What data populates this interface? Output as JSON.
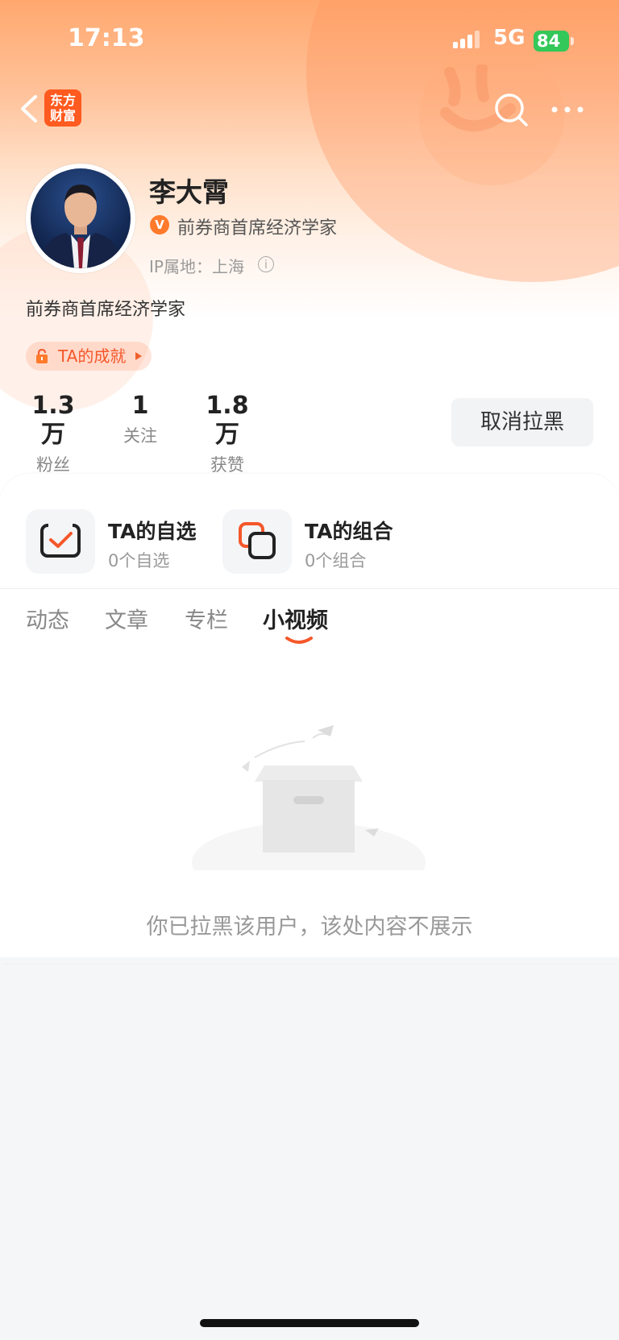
{
  "status_bar": {
    "time": "17:13",
    "network": "5G",
    "battery": "84"
  },
  "header": {
    "logo_text_1": "东方",
    "logo_text_2": "财富"
  },
  "profile": {
    "name": "李大霄",
    "verified_badge": "V",
    "verified_title": "前券商首席经济学家",
    "ip_location": "IP属地：上海",
    "bio": "前券商首席经济学家",
    "achievement_label": "TA的成就"
  },
  "stats": [
    {
      "value": "1.3万",
      "label": "粉丝"
    },
    {
      "value": "1",
      "label": "关注"
    },
    {
      "value": "1.8万",
      "label": "获赞"
    }
  ],
  "unblock_label": "取消拉黑",
  "cards": [
    {
      "title": "TA的自选",
      "subtitle": "0个自选"
    },
    {
      "title": "TA的组合",
      "subtitle": "0个组合"
    }
  ],
  "tabs": [
    {
      "label": "动态",
      "active": false
    },
    {
      "label": "文章",
      "active": false
    },
    {
      "label": "专栏",
      "active": false
    },
    {
      "label": "小视频",
      "active": true
    }
  ],
  "empty_message": "你已拉黑该用户，该处内容不展示",
  "colors": {
    "accent": "#f5572a",
    "battery": "#34c759",
    "badge": "#ff7a2b"
  },
  "icons": [
    "back-arrow-icon",
    "search-icon",
    "more-icon",
    "verified-icon",
    "info-icon",
    "lock-icon",
    "watchlist-check-icon",
    "portfolio-icon",
    "empty-box-illustration"
  ]
}
